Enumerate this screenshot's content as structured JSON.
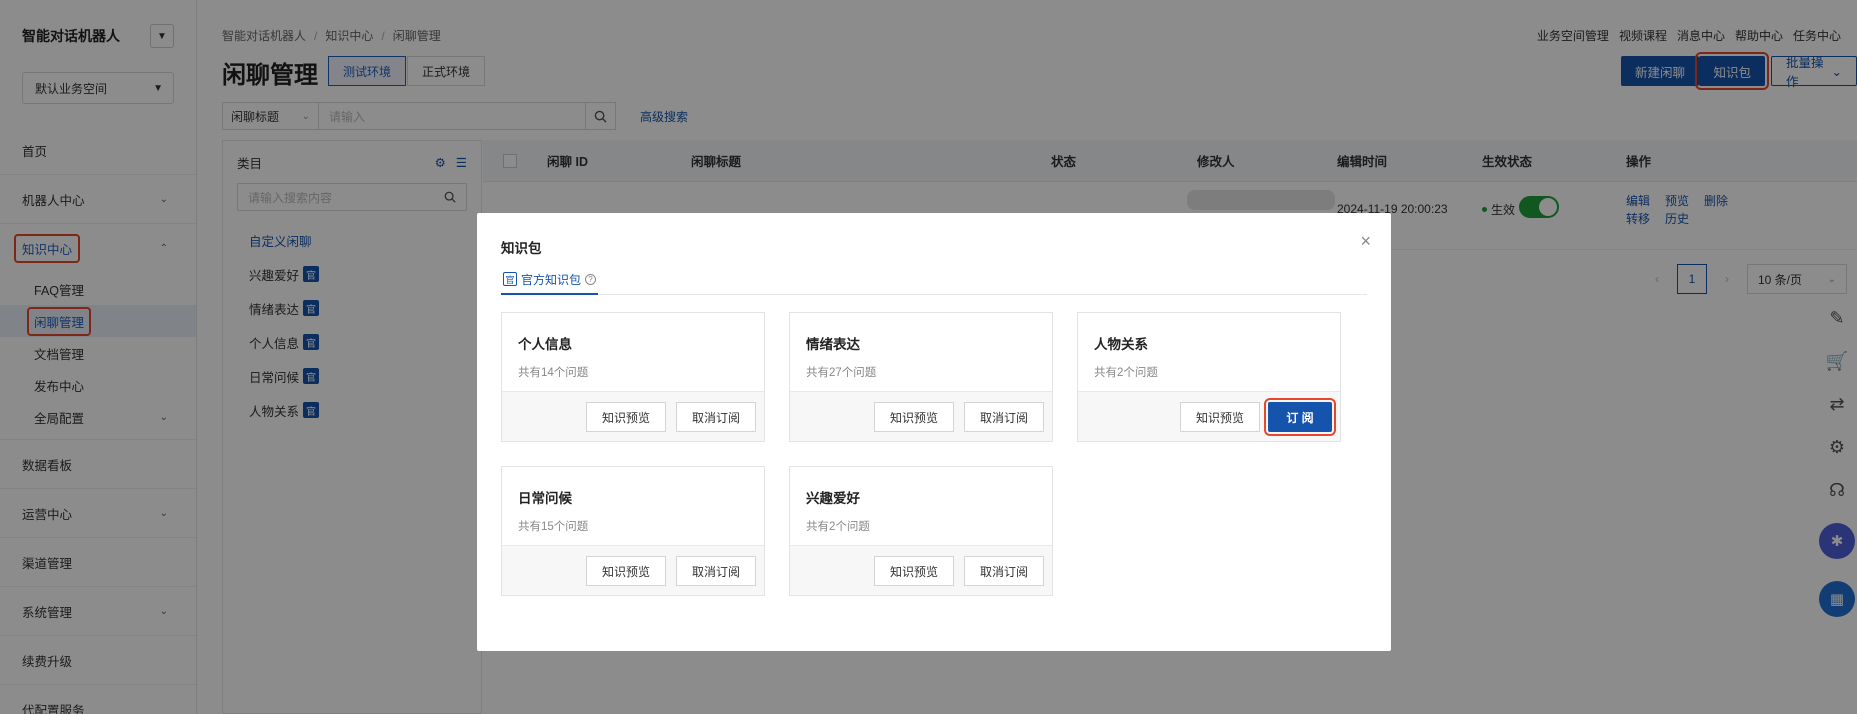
{
  "sidebar": {
    "title": "智能对话机器人",
    "workspace": "默认业务空间",
    "items": [
      {
        "label": "首页"
      },
      {
        "label": "机器人中心"
      },
      {
        "label": "知识中心"
      },
      {
        "label": "数据看板"
      },
      {
        "label": "运营中心"
      },
      {
        "label": "渠道管理"
      },
      {
        "label": "系统管理"
      },
      {
        "label": "续费升级"
      },
      {
        "label": "代配置服务"
      }
    ],
    "sub_items": [
      {
        "label": "FAQ管理"
      },
      {
        "label": "闲聊管理"
      },
      {
        "label": "文档管理"
      },
      {
        "label": "发布中心"
      },
      {
        "label": "全局配置"
      }
    ]
  },
  "header": {
    "breadcrumb": [
      "智能对话机器人",
      "知识中心",
      "闲聊管理"
    ],
    "toplinks": [
      "业务空间管理",
      "视频课程",
      "消息中心",
      "帮助中心",
      "任务中心"
    ],
    "page_title": "闲聊管理",
    "env_test": "测试环境",
    "env_prod": "正式环境",
    "btn_new": "新建闲聊",
    "btn_kp": "知识包",
    "btn_batch": "批量操作"
  },
  "search": {
    "select": "闲聊标题",
    "placeholder": "请输入",
    "advanced": "高级搜索"
  },
  "category": {
    "header": "类目",
    "search_placeholder": "请输入搜索内容",
    "items": [
      {
        "label": "自定义闲聊"
      },
      {
        "label": "兴趣爱好",
        "badge": "官"
      },
      {
        "label": "情绪表达",
        "badge": "官"
      },
      {
        "label": "个人信息",
        "badge": "官"
      },
      {
        "label": "日常问候",
        "badge": "官"
      },
      {
        "label": "人物关系",
        "badge": "官"
      }
    ]
  },
  "table": {
    "columns": [
      "闲聊 ID",
      "闲聊标题",
      "状态",
      "修改人",
      "编辑时间",
      "生效状态",
      "操作"
    ],
    "row": {
      "time": "2024-11-19 20:00:23",
      "effect": "生效",
      "actions": [
        "编辑",
        "预览",
        "删除",
        "转移",
        "历史"
      ]
    },
    "pager": {
      "page": "1",
      "size": "10 条/页"
    }
  },
  "modal": {
    "title": "知识包",
    "tab": "官方知识包",
    "tab_icon": "官",
    "close": "×",
    "preview_label": "知识预览",
    "unsub_label": "取消订阅",
    "sub_label": "订 阅",
    "cards": [
      {
        "title": "个人信息",
        "sub": "共有14个问题"
      },
      {
        "title": "情绪表达",
        "sub": "共有27个问题"
      },
      {
        "title": "人物关系",
        "sub": "共有2个问题"
      },
      {
        "title": "日常问候",
        "sub": "共有15个问题"
      },
      {
        "title": "兴趣爱好",
        "sub": "共有2个问题"
      }
    ]
  },
  "colors": {
    "primary": "#1554ad",
    "highlight": "#e8472b",
    "toggle": "#1e9e3b"
  }
}
